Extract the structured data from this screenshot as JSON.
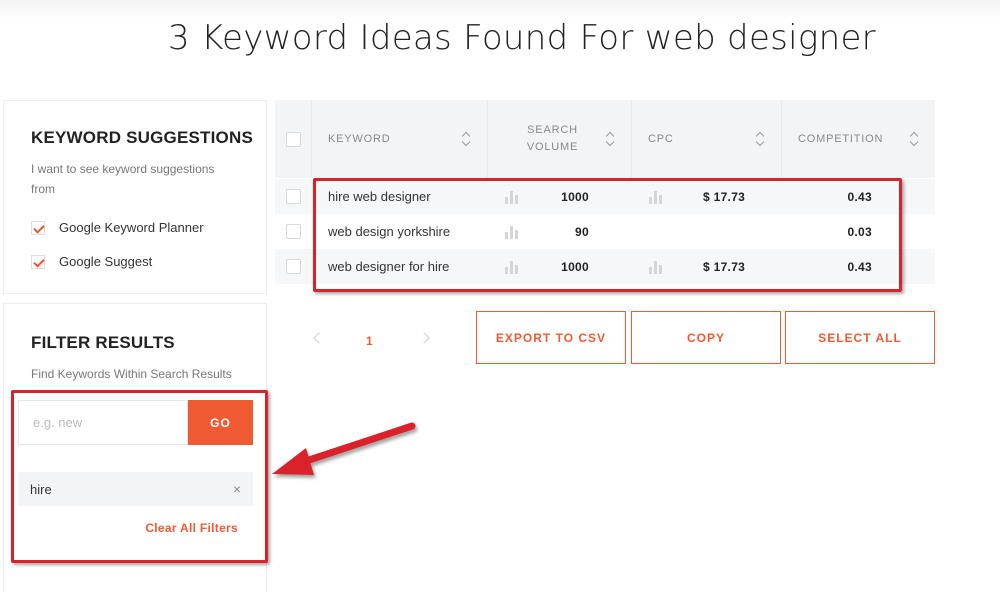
{
  "page_title": "3 Keyword Ideas Found For web designer",
  "suggestions": {
    "heading": "KEYWORD SUGGESTIONS",
    "description": "I want to see keyword suggestions from",
    "options": [
      {
        "label": "Google Keyword Planner",
        "checked": true
      },
      {
        "label": "Google Suggest",
        "checked": true
      }
    ]
  },
  "filter": {
    "heading": "FILTER RESULTS",
    "description": "Find Keywords Within Search Results",
    "input_placeholder": "e.g. new",
    "input_value": "",
    "go_label": "GO",
    "active_tag": "hire",
    "remove_icon": "×",
    "clear_label": "Clear All Filters"
  },
  "table": {
    "columns": [
      "KEYWORD",
      "SEARCH VOLUME",
      "CPC",
      "COMPETITION"
    ],
    "rows": [
      {
        "keyword": "hire web designer",
        "volume": "1000",
        "cpc": "$ 17.73",
        "competition": "0.43"
      },
      {
        "keyword": "web design yorkshire",
        "volume": "90",
        "cpc": "",
        "competition": "0.03"
      },
      {
        "keyword": "web designer for hire",
        "volume": "1000",
        "cpc": "$ 17.73",
        "competition": "0.43"
      }
    ]
  },
  "pagination": {
    "current_page": "1"
  },
  "actions": {
    "export_label": "EXPORT TO CSV",
    "copy_label": "COPY",
    "select_all_label": "SELECT ALL"
  },
  "colors": {
    "accent": "#f05a32",
    "highlight": "#d9232a"
  }
}
